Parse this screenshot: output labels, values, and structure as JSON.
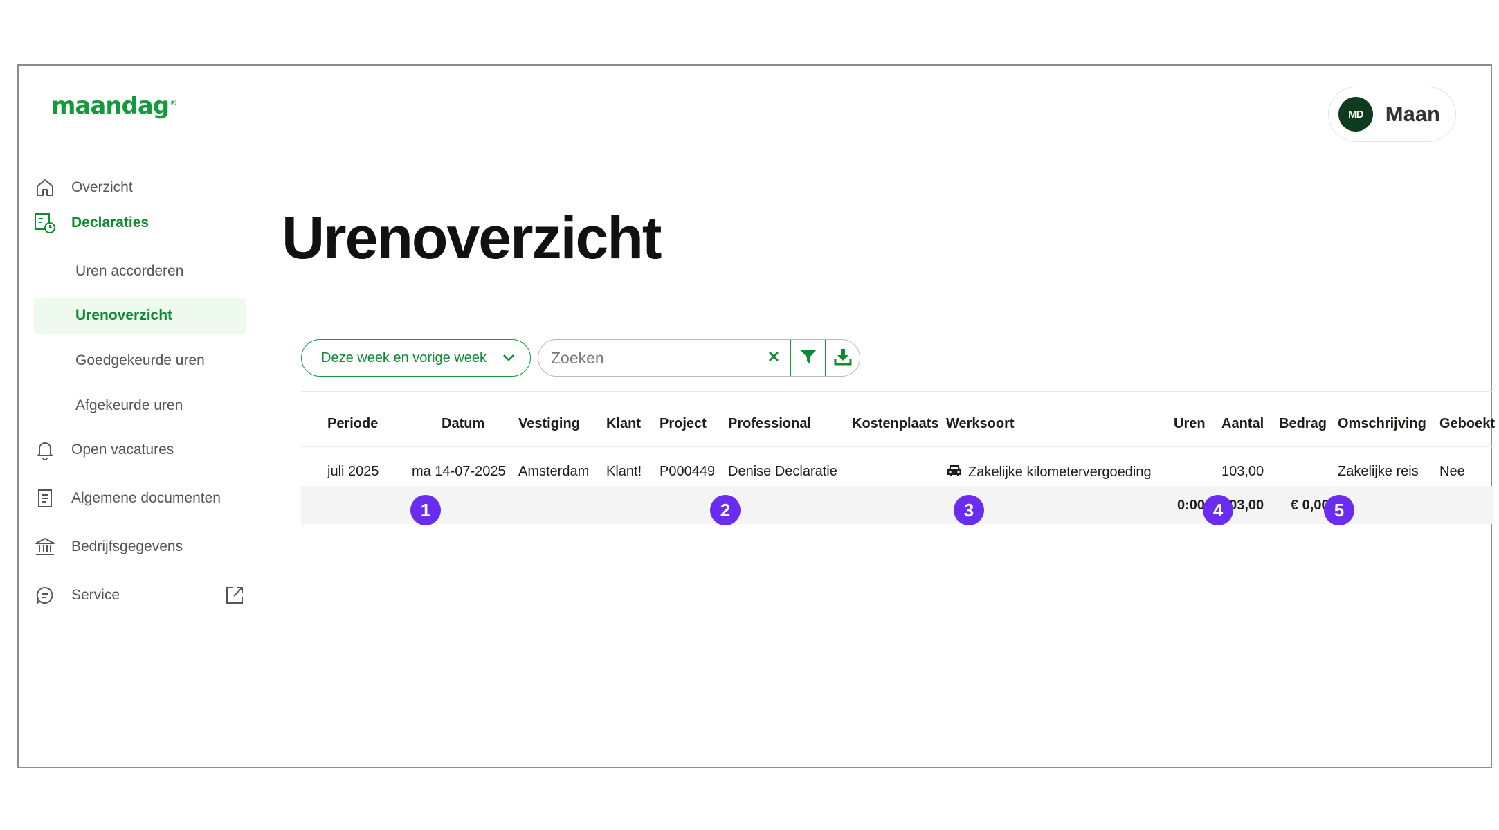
{
  "brand": {
    "logo": "maandag",
    "logo_mark": "®"
  },
  "account": {
    "initials": "MD",
    "name": "Maan"
  },
  "sidebar": {
    "items": [
      {
        "label": "Overzicht",
        "icon": "home-icon"
      },
      {
        "label": "Declaraties",
        "icon": "declarations-icon"
      },
      {
        "label": "Open vacatures",
        "icon": "bell-icon"
      },
      {
        "label": "Algemene documenten",
        "icon": "document-icon"
      },
      {
        "label": "Bedrijfsgegevens",
        "icon": "bank-icon"
      },
      {
        "label": "Service",
        "icon": "chat-icon"
      }
    ],
    "subitems": [
      {
        "label": "Uren accorderen"
      },
      {
        "label": "Urenoverzicht"
      },
      {
        "label": "Goedgekeurde uren"
      },
      {
        "label": "Afgekeurde uren"
      }
    ],
    "service_external_icon": "external-link-icon"
  },
  "page": {
    "title": "Urenoverzicht"
  },
  "toolbar": {
    "period_value": "Deze week en vorige week",
    "search_placeholder": "Zoeken",
    "clear_icon": "close-icon",
    "filter_icon": "filter-icon",
    "download_icon": "download-icon"
  },
  "table": {
    "columns": [
      "Periode",
      "Datum",
      "Vestiging",
      "Klant",
      "Project",
      "Professional",
      "Kostenplaats",
      "Werksoort",
      "Uren",
      "Aantal",
      "Bedrag",
      "Omschrijving",
      "Geboekt"
    ],
    "rows": [
      {
        "periode": "juli 2025",
        "datum": "ma 14-07-2025",
        "vestiging": "Amsterdam",
        "klant": "Klant!",
        "project": "P000449",
        "professional": "Denise Declaratie",
        "kostenplaats": "",
        "werksoort_icon": "car-icon",
        "werksoort": "Zakelijke kilometervergoeding",
        "uren": "",
        "aantal": "103,00",
        "bedrag": "",
        "omschrijving": "Zakelijke reis",
        "geboekt": "Nee"
      }
    ],
    "totals": {
      "uren": "0:00",
      "aantal": "103,00",
      "bedrag": "€ 0,00"
    }
  },
  "markers": [
    "1",
    "2",
    "3",
    "4",
    "5"
  ],
  "colors": {
    "brand_green": "#129b3a",
    "marker_purple": "#6a2cf0",
    "avatar_bg": "#0c3b1f"
  }
}
